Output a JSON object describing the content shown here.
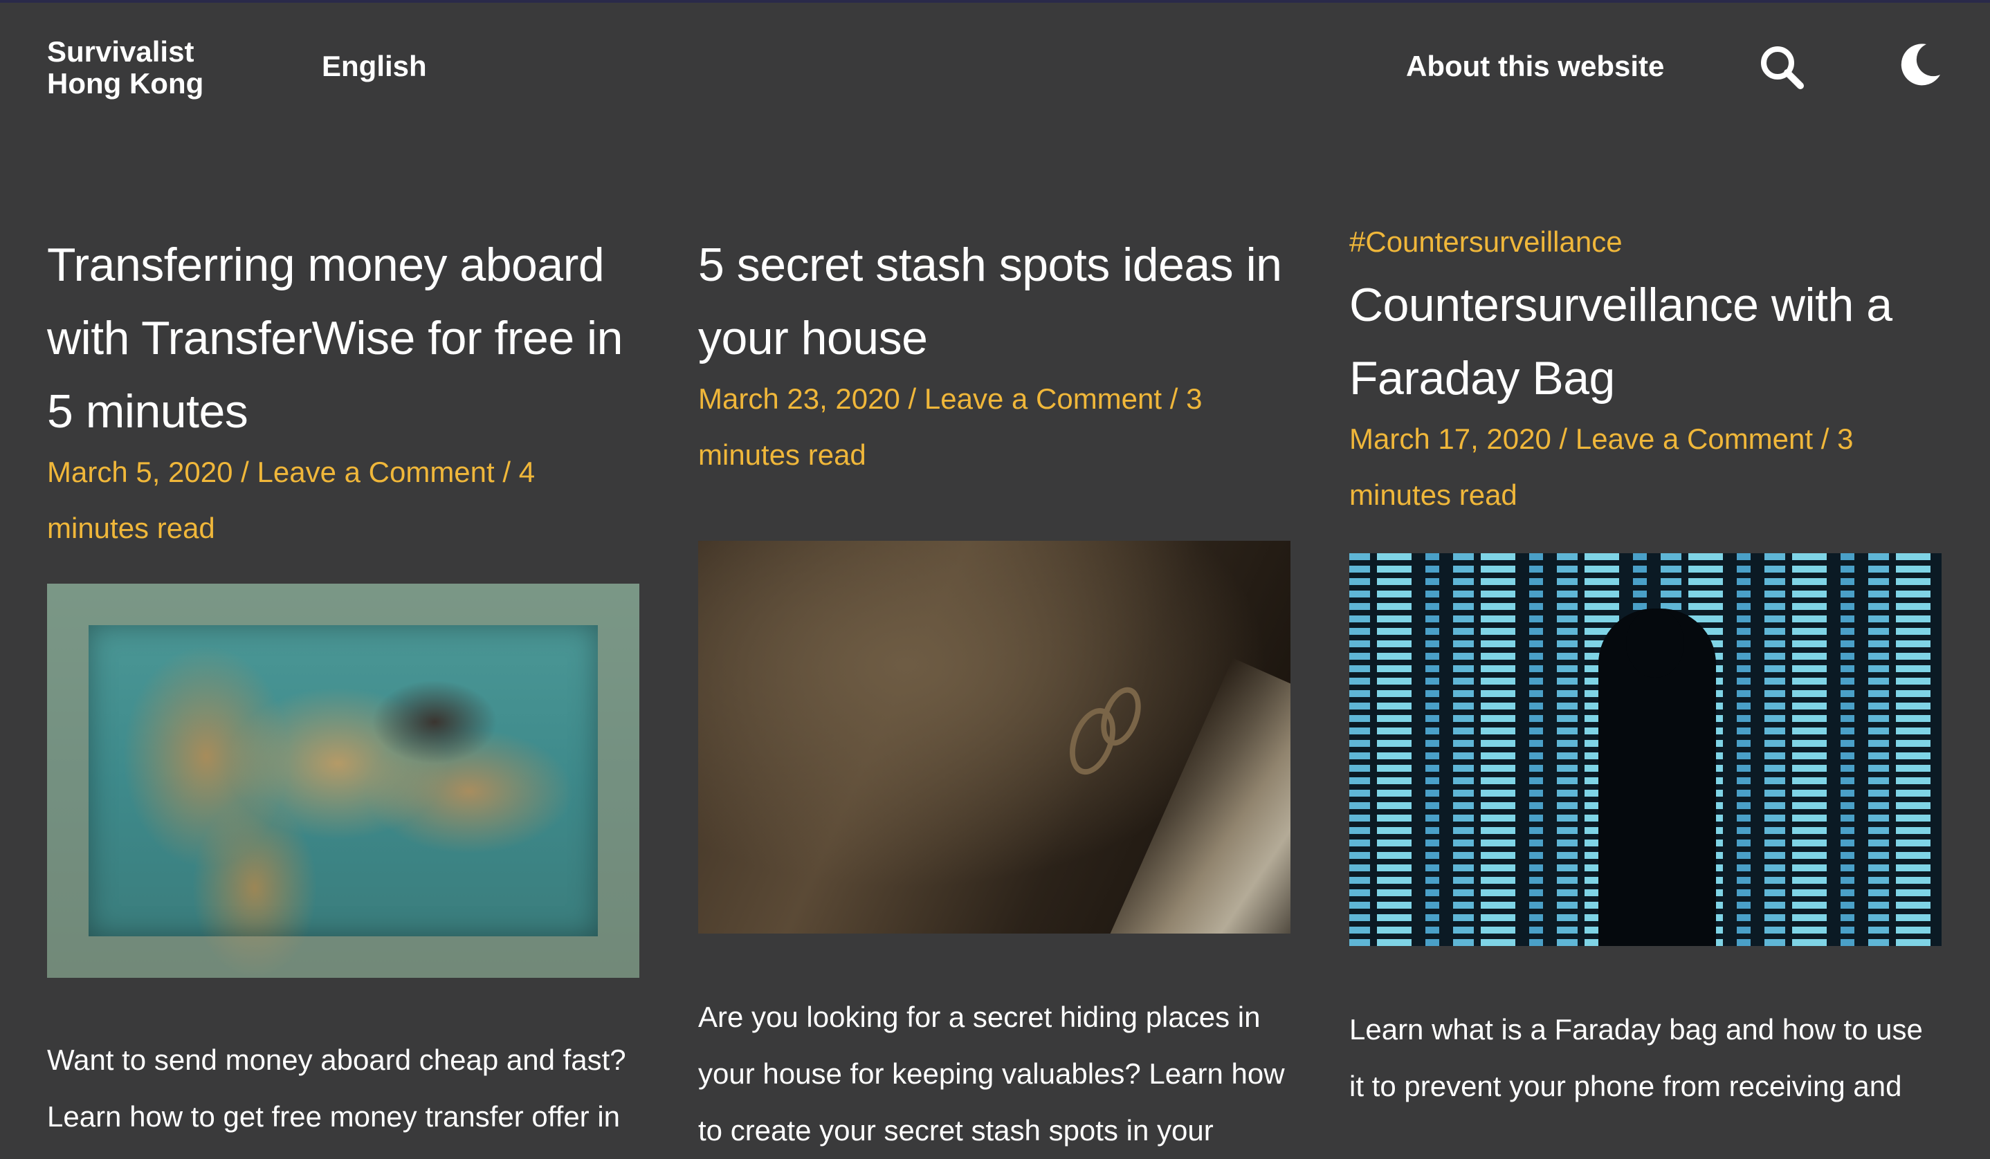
{
  "header": {
    "brand_line1": "Survivalist",
    "brand_line2": "Hong Kong",
    "language": "English",
    "about": "About this website",
    "search_icon": "search-icon",
    "theme_icon": "moon-icon"
  },
  "posts": [
    {
      "tag": "",
      "title": "Transferring money aboard with TransferWise for free in 5 minutes",
      "date": "March 5, 2020",
      "comment_link": "Leave a Comment",
      "read_time": "4 minutes read",
      "excerpt": "Want to send money aboard cheap and fast? Learn how to get free money transfer offer in"
    },
    {
      "tag": "",
      "title": "5 secret stash spots ideas in your house",
      "date": "March 23, 2020",
      "comment_link": "Leave a Comment",
      "read_time": "3 minutes read",
      "excerpt": "Are you looking for a secret hiding places in your house for keeping valuables? Learn how to create your secret stash spots in your"
    },
    {
      "tag": "#Countersurveillance",
      "title": "Countersurveillance with a Faraday Bag",
      "date": "March 17, 2020",
      "comment_link": "Leave a Comment",
      "read_time": "3 minutes read",
      "excerpt": "Learn what is a Faraday bag and how to use it to prevent your phone from receiving and"
    }
  ],
  "colors": {
    "background": "#3a3a3b",
    "accent": "#f0b73a",
    "text": "#ffffff"
  }
}
